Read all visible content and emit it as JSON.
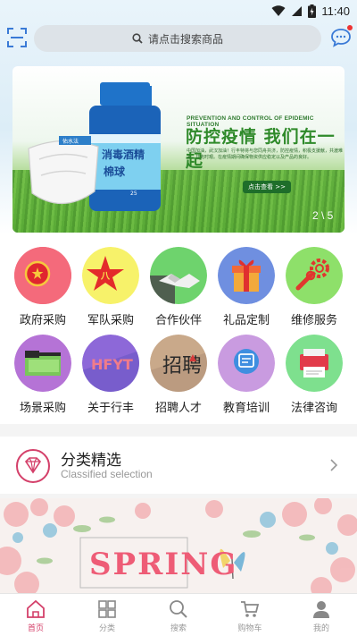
{
  "status_bar": {
    "time": "11:40"
  },
  "search": {
    "placeholder": "请点击搜索商品"
  },
  "banner": {
    "title_en": "PREVENTION AND CONTROL OF EPIDEMIC SITUATION",
    "title_cn": "防控疫情 我们在一起",
    "body": "中国加油，武汉加油！行丰特将与您同舟共济，防控疫情，积极支援献，共渡难关，共克时艰。在疫情期间确保物资供应稳定以及产品的良好。",
    "button_label": "点击查看 >>",
    "page_index": "2 \\ 5",
    "product_labels": [
      "消毒酒精",
      "棉球",
      "25",
      "佑水法"
    ]
  },
  "categories": [
    {
      "label": "政府采购",
      "icon": "national-emblem-icon"
    },
    {
      "label": "军队采购",
      "icon": "army-star-icon"
    },
    {
      "label": "合作伙伴",
      "icon": "handshake-icon"
    },
    {
      "label": "礼品定制",
      "icon": "gift-icon"
    },
    {
      "label": "维修服务",
      "icon": "wrench-gear-icon"
    },
    {
      "label": "场景采购",
      "icon": "scene-folder-icon"
    },
    {
      "label": "关于行丰",
      "icon": "hfyt-logo-icon"
    },
    {
      "label": "招聘人才",
      "icon": "recruit-icon"
    },
    {
      "label": "教育培训",
      "icon": "education-chat-icon"
    },
    {
      "label": "法律咨询",
      "icon": "printer-icon"
    }
  ],
  "category_logo_text": {
    "about": "HFYT",
    "recruit": "招聘"
  },
  "classified": {
    "title": "分类精选",
    "subtitle": "Classified selection"
  },
  "spring_banner": {
    "text": "SPRING"
  },
  "tabs": [
    {
      "label": "首页",
      "icon": "home-icon",
      "active": true
    },
    {
      "label": "分类",
      "icon": "grid-icon",
      "active": false
    },
    {
      "label": "搜索",
      "icon": "search-icon",
      "active": false
    },
    {
      "label": "购物车",
      "icon": "cart-icon",
      "active": false
    },
    {
      "label": "我的",
      "icon": "user-icon",
      "active": false
    }
  ],
  "colors": {
    "accent": "#d4406a",
    "tab_inactive": "#999999",
    "search_bg": "#dde3e8"
  }
}
